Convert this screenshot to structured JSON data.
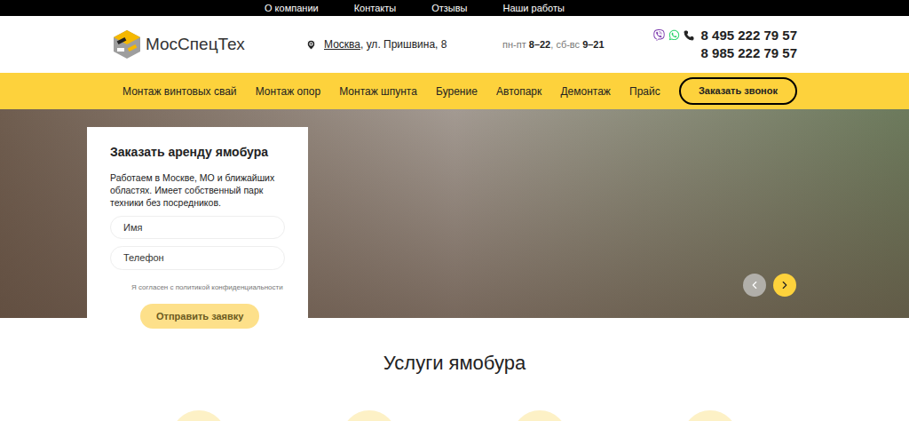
{
  "top_nav": [
    "О компании",
    "Контакты",
    "Отзывы",
    "Наши работы"
  ],
  "logo": {
    "name": "МосСпецТех"
  },
  "address": {
    "city": "Москва",
    "street": ", ул. Пришвина, 8"
  },
  "hours": {
    "items": [
      {
        "days": "пн-пт",
        "time": "8–22"
      },
      {
        "days": "сб-вс",
        "time": "9–21"
      }
    ],
    "separator": ", "
  },
  "phones": [
    "8 495 222 79 57",
    "8 985 222 79 57"
  ],
  "main_nav": [
    "Монтаж винтовых свай",
    "Монтаж опор",
    "Монтаж шпунта",
    "Бурение",
    "Автопарк",
    "Демонтаж",
    "Прайс"
  ],
  "callback_button": "Заказать звонок",
  "form": {
    "title": "Заказать аренду ямобура",
    "description": "Работаем в Москве, МО и ближайших областях. Имеет собственный парк техники без посредников.",
    "fields": [
      {
        "placeholder": "Имя"
      },
      {
        "placeholder": "Телефон"
      }
    ],
    "consent": "Я согласен с политикой конфиденциальности",
    "submit": "Отправить заявку"
  },
  "slider": {
    "prev_active": false,
    "next_active": true
  },
  "section_title": "Услуги ямобура"
}
